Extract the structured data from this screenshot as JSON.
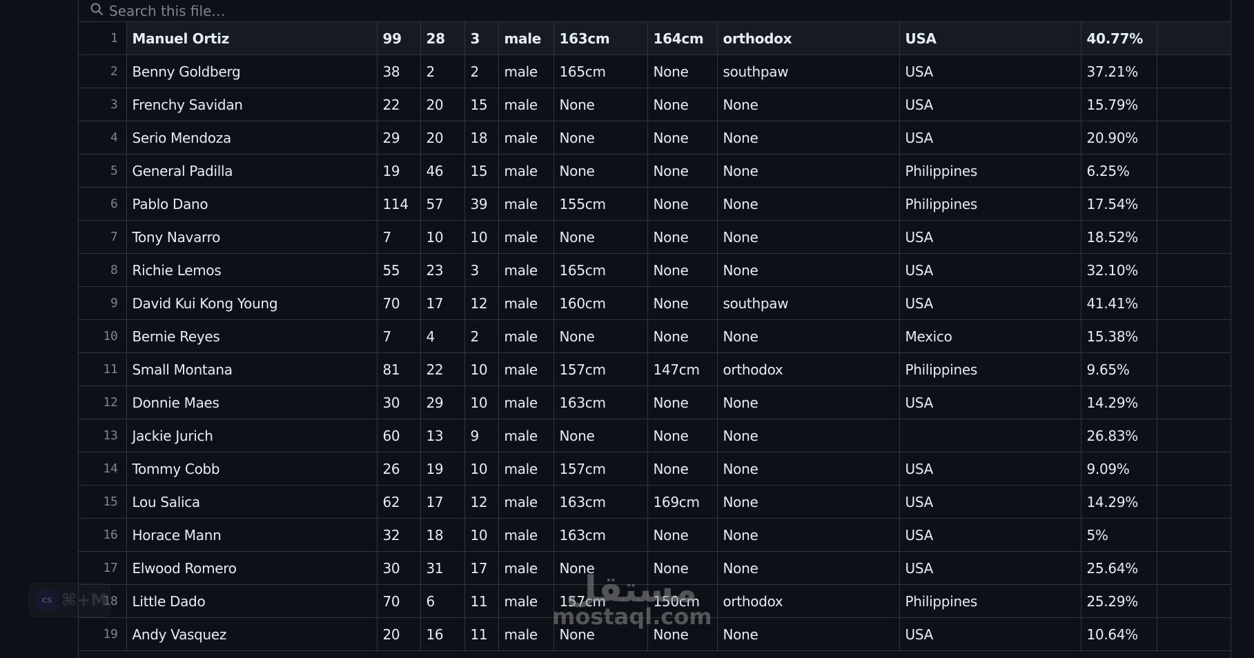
{
  "search": {
    "placeholder": "Search this file…",
    "icon": "search-icon"
  },
  "table": {
    "header": {
      "row_number": "1",
      "cells": [
        "Manuel Ortiz",
        "99",
        "28",
        "3",
        "male",
        "163cm",
        "164cm",
        "orthodox",
        "USA",
        "40.77%",
        ""
      ]
    },
    "rows": [
      {
        "n": "2",
        "cells": [
          "Benny Goldberg",
          "38",
          "2",
          "2",
          "male",
          "165cm",
          "None",
          "southpaw",
          "USA",
          "37.21%",
          ""
        ]
      },
      {
        "n": "3",
        "cells": [
          "Frenchy Savidan",
          "22",
          "20",
          "15",
          "male",
          "None",
          "None",
          "None",
          "USA",
          "15.79%",
          ""
        ]
      },
      {
        "n": "4",
        "cells": [
          "Serio Mendoza",
          "29",
          "20",
          "18",
          "male",
          "None",
          "None",
          "None",
          "USA",
          "20.90%",
          ""
        ]
      },
      {
        "n": "5",
        "cells": [
          "General Padilla",
          "19",
          "46",
          "15",
          "male",
          "None",
          "None",
          "None",
          "Philippines",
          "6.25%",
          ""
        ]
      },
      {
        "n": "6",
        "cells": [
          "Pablo Dano",
          "114",
          "57",
          "39",
          "male",
          "155cm",
          "None",
          "None",
          "Philippines",
          "17.54%",
          ""
        ]
      },
      {
        "n": "7",
        "cells": [
          "Tony Navarro",
          "7",
          "10",
          "10",
          "male",
          "None",
          "None",
          "None",
          "USA",
          "18.52%",
          ""
        ]
      },
      {
        "n": "8",
        "cells": [
          "Richie Lemos",
          "55",
          "23",
          "3",
          "male",
          "165cm",
          "None",
          "None",
          "USA",
          "32.10%",
          ""
        ]
      },
      {
        "n": "9",
        "cells": [
          "David Kui Kong Young",
          "70",
          "17",
          "12",
          "male",
          "160cm",
          "None",
          "southpaw",
          "USA",
          "41.41%",
          ""
        ]
      },
      {
        "n": "10",
        "cells": [
          "Bernie Reyes",
          "7",
          "4",
          "2",
          "male",
          "None",
          "None",
          "None",
          "Mexico",
          "15.38%",
          ""
        ]
      },
      {
        "n": "11",
        "cells": [
          "Small Montana",
          "81",
          "22",
          "10",
          "male",
          "157cm",
          "147cm",
          "orthodox",
          "Philippines",
          "9.65%",
          ""
        ]
      },
      {
        "n": "12",
        "cells": [
          "Donnie Maes",
          "30",
          "29",
          "10",
          "male",
          "163cm",
          "None",
          "None",
          "USA",
          "14.29%",
          ""
        ]
      },
      {
        "n": "13",
        "cells": [
          "Jackie Jurich",
          "60",
          "13",
          "9",
          "male",
          "None",
          "None",
          "None",
          "",
          "26.83%",
          ""
        ]
      },
      {
        "n": "14",
        "cells": [
          "Tommy Cobb",
          "26",
          "19",
          "10",
          "male",
          "157cm",
          "None",
          "None",
          "USA",
          "9.09%",
          ""
        ]
      },
      {
        "n": "15",
        "cells": [
          "Lou Salica",
          "62",
          "17",
          "12",
          "male",
          "163cm",
          "169cm",
          "None",
          "USA",
          "14.29%",
          ""
        ]
      },
      {
        "n": "16",
        "cells": [
          "Horace Mann",
          "32",
          "18",
          "10",
          "male",
          "163cm",
          "None",
          "None",
          "USA",
          "5%",
          ""
        ]
      },
      {
        "n": "17",
        "cells": [
          "Elwood Romero",
          "30",
          "31",
          "17",
          "male",
          "None",
          "None",
          "None",
          "USA",
          "25.64%",
          ""
        ]
      },
      {
        "n": "18",
        "cells": [
          "Little Dado",
          "70",
          "6",
          "11",
          "male",
          "157cm",
          "150cm",
          "orthodox",
          "Philippines",
          "25.29%",
          ""
        ]
      },
      {
        "n": "19",
        "cells": [
          "Andy Vasquez",
          "20",
          "16",
          "11",
          "male",
          "None",
          "None",
          "None",
          "USA",
          "10.64%",
          ""
        ]
      }
    ]
  },
  "overlay_badge": {
    "logo_text": "cs",
    "shortcut": "⌘+M"
  },
  "watermark": {
    "arabic": "مستقل",
    "latin": "mostaql.com"
  }
}
